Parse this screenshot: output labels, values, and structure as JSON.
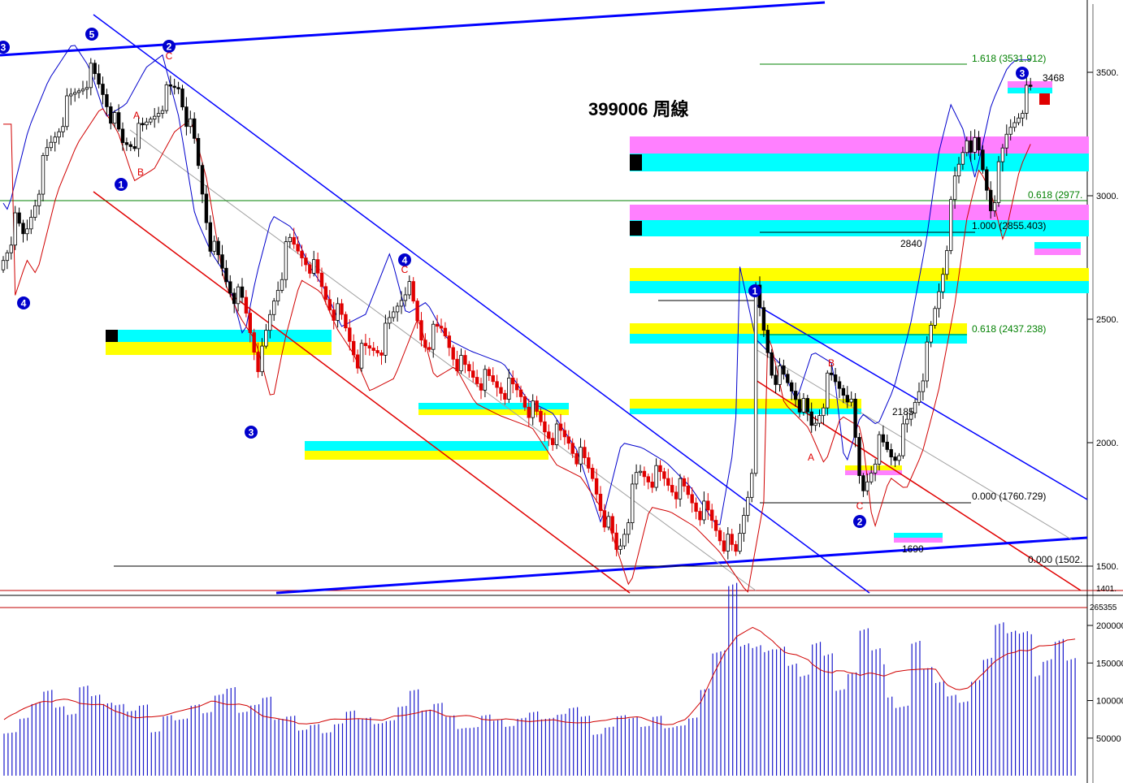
{
  "chart_data": {
    "type": "candlestick",
    "title": "399006 周線",
    "price_axis": {
      "ticks": [
        {
          "v": 3500,
          "label": "3500."
        },
        {
          "v": 3000,
          "label": "3000."
        },
        {
          "v": 2500,
          "label": "2500."
        },
        {
          "v": 2000,
          "label": "2000."
        },
        {
          "v": 1500,
          "label": "1500."
        }
      ],
      "bottom_label": "1401.",
      "ylim": [
        1401,
        3700
      ]
    },
    "volume_axis": {
      "ticks": [
        {
          "v": 200000,
          "label": "200000"
        },
        {
          "v": 150000,
          "label": "150000"
        },
        {
          "v": 100000,
          "label": "100000"
        },
        {
          "v": 50000,
          "label": "50000"
        }
      ],
      "top_label": "265355",
      "ylim": [
        0,
        220000
      ]
    },
    "fib_levels": [
      {
        "label": "1.618 (3531.912)",
        "value": 3531.912,
        "color": "#008000"
      },
      {
        "label": "0.618 (2977.",
        "value": 2977,
        "color": "#008000"
      },
      {
        "label": "1.000 (2855.403)",
        "value": 2855.403,
        "color": "#000000"
      },
      {
        "label": "0.618 (2437.238)",
        "value": 2437.238,
        "color": "#008000"
      },
      {
        "label": "0.000 (1760.729)",
        "value": 1760.729,
        "color": "#000000"
      },
      {
        "label": "0.000 (1502.",
        "value": 1502,
        "color": "#000000"
      }
    ],
    "price_notes": [
      "3468",
      "2840",
      "2185",
      "1690"
    ],
    "wave_labels": [
      {
        "text": "3",
        "color": "blue",
        "circled": true
      },
      {
        "text": "5",
        "color": "blue",
        "circled": true
      },
      {
        "text": "2",
        "color": "blue",
        "circled": true
      },
      {
        "text": "C",
        "color": "red"
      },
      {
        "text": "A",
        "color": "red"
      },
      {
        "text": "B",
        "color": "red"
      },
      {
        "text": "1",
        "color": "blue",
        "circled": true
      },
      {
        "text": "4",
        "color": "blue",
        "circled": true
      },
      {
        "text": "3",
        "color": "blue",
        "circled": true
      },
      {
        "text": "4",
        "color": "blue",
        "circled": true
      },
      {
        "text": "C",
        "color": "red"
      },
      {
        "text": "1",
        "color": "blue",
        "circled": true
      },
      {
        "text": "A",
        "color": "red"
      },
      {
        "text": "B",
        "color": "red"
      },
      {
        "text": "C",
        "color": "red"
      },
      {
        "text": "2",
        "color": "blue",
        "circled": true
      },
      {
        "text": "3",
        "color": "blue",
        "circled": true
      }
    ],
    "volume_sample": [
      70000,
      90000,
      110000,
      125000,
      98000,
      85000,
      120000,
      105000,
      92000,
      88000,
      78000,
      83000,
      72000,
      95000,
      86000,
      104000,
      90000,
      112000,
      118000,
      83000,
      90000,
      97000,
      68000,
      70000,
      75000,
      81000,
      66000,
      77000,
      93000,
      80000,
      70000,
      72000,
      88000,
      106000,
      79000,
      85000,
      98000,
      75000,
      74000,
      90000,
      80000,
      69000,
      78000,
      84000,
      73000,
      76000,
      82000,
      70000,
      68000,
      77000,
      92000,
      86000,
      71000,
      83000,
      65000,
      66000,
      74000,
      108000,
      150000,
      225000,
      215000,
      205000,
      192000,
      190000,
      160000,
      140000,
      180000,
      160000,
      110000,
      128000,
      178000,
      150000,
      130000,
      110000,
      205000,
      160000,
      135000,
      112000,
      100000,
      125000,
      150000,
      190000,
      175000,
      170000,
      165000,
      185000,
      210000,
      175000
    ]
  }
}
